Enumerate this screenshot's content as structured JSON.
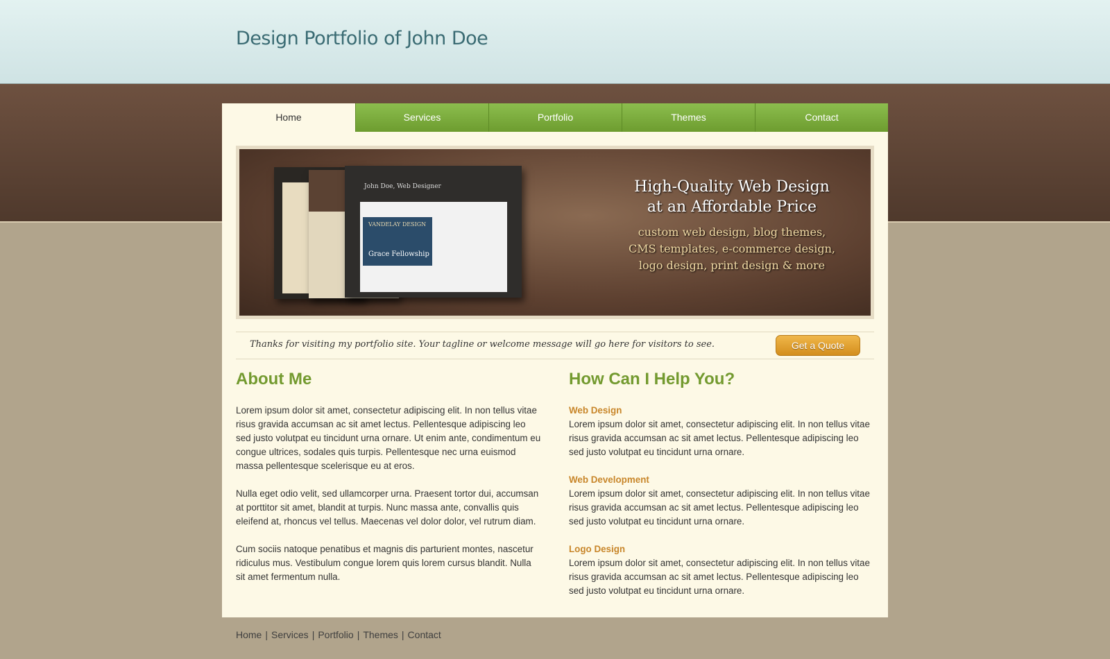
{
  "site": {
    "title": "Design Portfolio of John Doe"
  },
  "nav": {
    "items": [
      {
        "label": "Home",
        "active": true
      },
      {
        "label": "Services"
      },
      {
        "label": "Portfolio"
      },
      {
        "label": "Themes"
      },
      {
        "label": "Contact"
      }
    ]
  },
  "banner": {
    "heading_line1": "High-Quality Web Design",
    "heading_line2": "at an Affordable Price",
    "sub_line1": "custom web design, blog themes,",
    "sub_line2": "CMS templates, e-commerce design,",
    "sub_line3": "logo design, print design & more",
    "mockup_title": "John Doe, Web Designer",
    "mockup_banner_text": "Grace Fellowship",
    "mockup_logo_text": "VANDELAY DESIGN"
  },
  "tagline": {
    "text": "Thanks for visiting my portfolio site. Your tagline or welcome message will go here for visitors to see.",
    "button_label": "Get a Quote"
  },
  "about": {
    "heading": "About Me",
    "paragraphs": [
      "Lorem ipsum dolor sit amet, consectetur adipiscing elit. In non tellus vitae risus gravida accumsan ac sit amet lectus. Pellentesque adipiscing leo sed justo volutpat eu tincidunt urna ornare. Ut enim ante, condimentum eu congue ultrices, sodales quis turpis. Pellentesque nec urna euismod massa pellentesque scelerisque eu at eros.",
      "Nulla eget odio velit, sed ullamcorper urna. Praesent tortor dui, accumsan at porttitor sit amet, blandit at turpis. Nunc massa ante, convallis quis eleifend at, rhoncus vel tellus. Maecenas vel dolor dolor, vel rutrum diam.",
      "Cum sociis natoque penatibus et magnis dis parturient montes, nascetur ridiculus mus. Vestibulum congue lorem quis lorem cursus blandit. Nulla sit amet fermentum nulla."
    ]
  },
  "help": {
    "heading": "How Can I Help You?",
    "services": [
      {
        "title": "Web Design",
        "text": "Lorem ipsum dolor sit amet, consectetur adipiscing elit. In non tellus vitae risus gravida accumsan ac sit amet lectus. Pellentesque adipiscing leo sed justo volutpat eu tincidunt urna ornare."
      },
      {
        "title": "Web Development",
        "text": "Lorem ipsum dolor sit amet, consectetur adipiscing elit. In non tellus vitae risus gravida accumsan ac sit amet lectus. Pellentesque adipiscing leo sed justo volutpat eu tincidunt urna ornare."
      },
      {
        "title": "Logo Design",
        "text": "Lorem ipsum dolor sit amet, consectetur adipiscing elit. In non tellus vitae risus gravida accumsan ac sit amet lectus. Pellentesque adipiscing leo sed justo volutpat eu tincidunt urna ornare."
      }
    ]
  },
  "footer": {
    "links": [
      "Home",
      "Services",
      "Portfolio",
      "Themes",
      "Contact"
    ],
    "separator": "|"
  },
  "colors": {
    "accent_green": "#739a2f",
    "service_orange": "#c8862a",
    "title_teal": "#3a6b73",
    "page_background": "#b1a48c",
    "content_background": "#fdf9e6"
  }
}
